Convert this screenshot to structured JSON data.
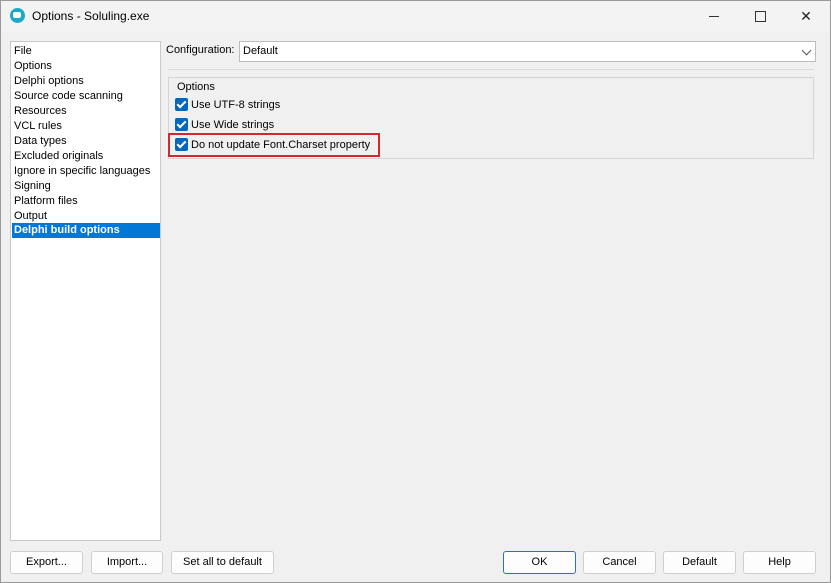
{
  "window": {
    "title": "Options - Soluling.exe",
    "accent_color": "#0078d7",
    "highlight_color": "#d9262c"
  },
  "nav": {
    "items": [
      "File",
      "Options",
      "Delphi options",
      "Source code scanning",
      "Resources",
      "VCL rules",
      "Data types",
      "Excluded originals",
      "Ignore in specific languages",
      "Signing",
      "Platform files",
      "Output",
      "Delphi build options"
    ],
    "selected": "Delphi build options"
  },
  "config": {
    "label": "Configuration:",
    "value": "Default"
  },
  "options": {
    "group_title": "Options",
    "checkboxes": [
      {
        "label": "Use UTF-8 strings",
        "checked": true
      },
      {
        "label": "Use Wide strings",
        "checked": true
      },
      {
        "label": "Do not update Font.Charset property",
        "checked": true
      }
    ]
  },
  "buttons": {
    "export": "Export...",
    "import": "Import...",
    "set_all": "Set all to default",
    "ok": "OK",
    "cancel": "Cancel",
    "default": "Default",
    "help": "Help"
  }
}
